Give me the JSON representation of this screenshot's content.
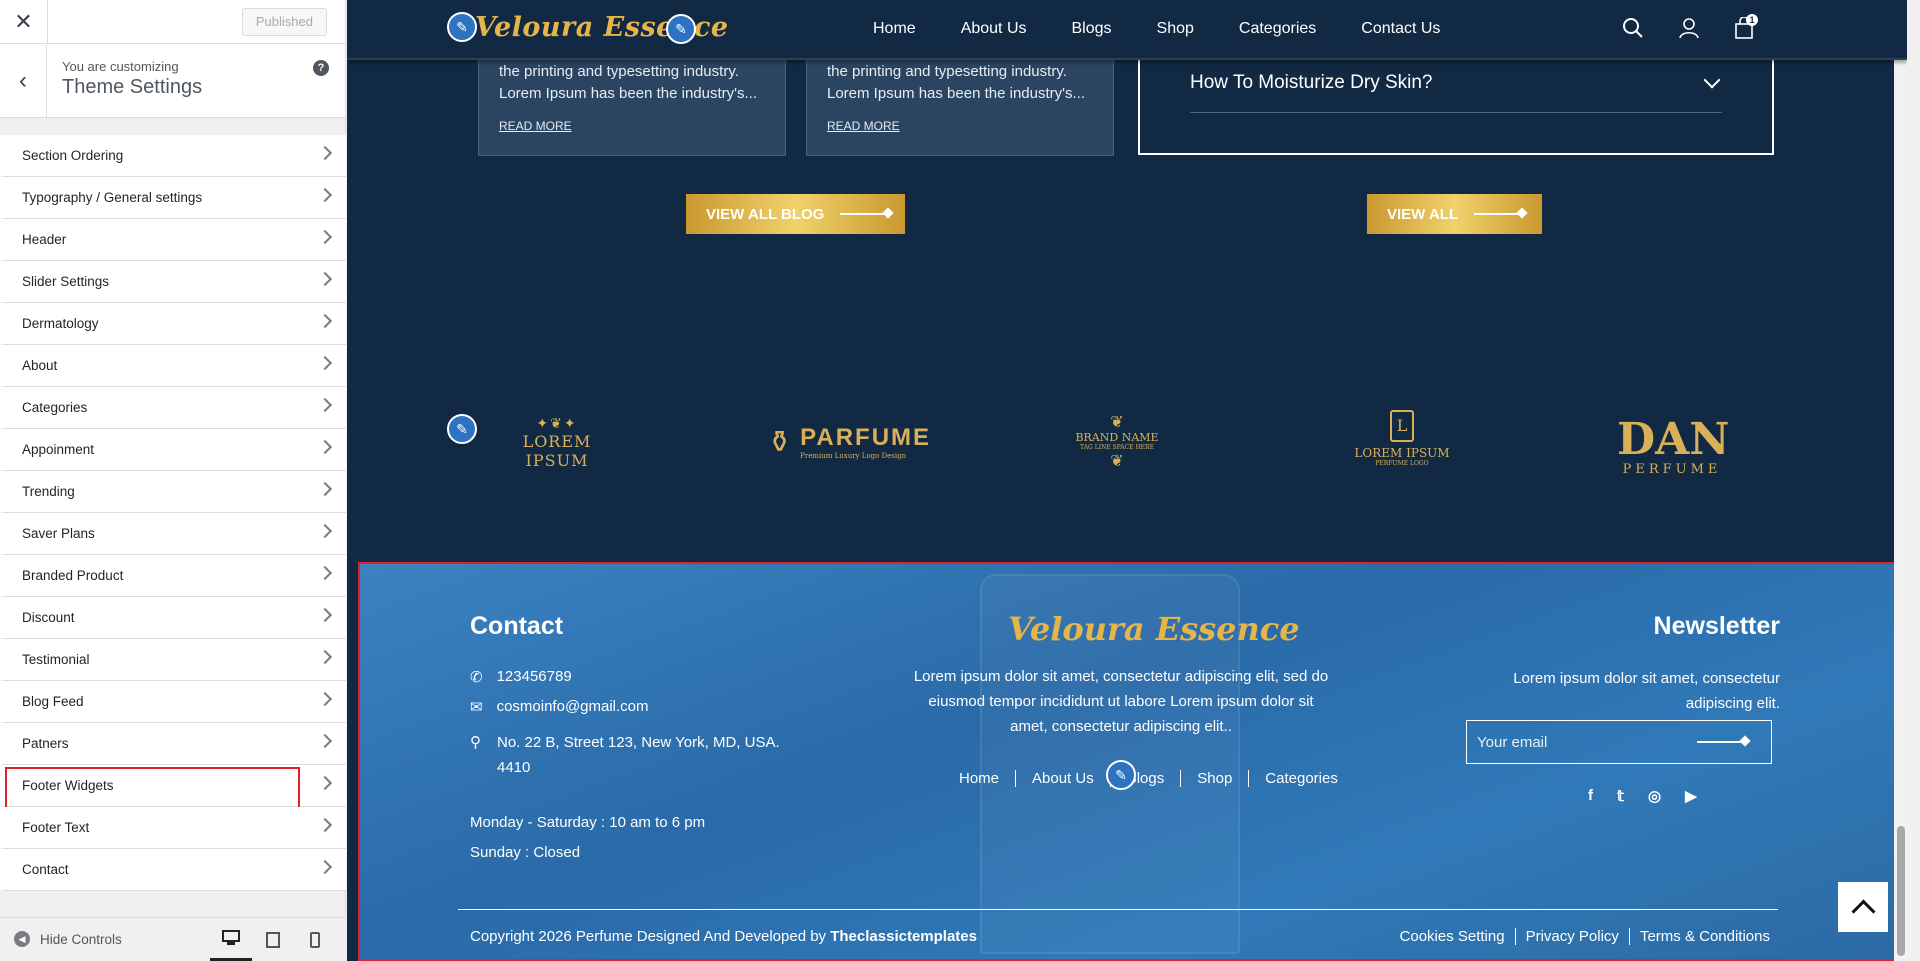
{
  "customizer": {
    "published_label": "Published",
    "customizing_label": "You are customizing",
    "section_title": "Theme Settings",
    "help_label": "?",
    "items": [
      {
        "label": "Section Ordering"
      },
      {
        "label": "Typography / General settings"
      },
      {
        "label": "Header"
      },
      {
        "label": "Slider Settings"
      },
      {
        "label": "Dermatology"
      },
      {
        "label": "About"
      },
      {
        "label": "Categories"
      },
      {
        "label": "Appoinment"
      },
      {
        "label": "Trending"
      },
      {
        "label": "Saver Plans"
      },
      {
        "label": "Branded Product"
      },
      {
        "label": "Discount"
      },
      {
        "label": "Testimonial"
      },
      {
        "label": "Blog Feed"
      },
      {
        "label": "Patners"
      },
      {
        "label": "Footer Widgets"
      },
      {
        "label": "Footer Text"
      },
      {
        "label": "Contact"
      }
    ],
    "highlighted_item": "Footer Widgets",
    "hide_controls_label": "Hide Controls",
    "devices": [
      "desktop-icon",
      "tablet-icon",
      "mobile-icon"
    ],
    "highlight_color": "#e0202a"
  },
  "site": {
    "logo_text": "Veloura Essence",
    "nav": [
      "Home",
      "About Us",
      "Blogs",
      "Shop",
      "Categories",
      "Contact Us"
    ],
    "cart_count": "1",
    "brand_gold": "#e6b54a",
    "bg_color": "#112943"
  },
  "blog": {
    "cards": [
      {
        "text": "the printing and typesetting industry. Lorem Ipsum has been the industry's...",
        "read_more": "READ MORE"
      },
      {
        "text": "the printing and typesetting industry. Lorem Ipsum has been the industry's...",
        "read_more": "READ MORE"
      }
    ],
    "view_all_blog": "VIEW ALL BLOG"
  },
  "faq": {
    "question": "How To Moisturize Dry Skin?",
    "view_all": "VIEW ALL"
  },
  "brands": [
    {
      "name": "LOREM IPSUM"
    },
    {
      "name": "PARFUME",
      "tagline": "Premium Luxury Logo Design"
    },
    {
      "name": "BRAND NAME",
      "tagline": "TAG LINE SPACE HERE"
    },
    {
      "name": "LOREM IPSUM",
      "tagline": "PERFUME LOGO",
      "monogram": "L"
    },
    {
      "name": "DAN",
      "tagline": "PERFUME"
    }
  ],
  "footer": {
    "contact_heading": "Contact",
    "phone": "123456789",
    "email": "cosmoinfo@gmail.com",
    "address_line1": "No. 22 B, Street 123, New York, MD, USA.",
    "address_line2": "4410",
    "hours_weekday": "Monday - Saturday : 10 am to 6 pm",
    "hours_sunday": "Sunday : Closed",
    "logo_text": "Veloura Essence",
    "about_text": "Lorem ipsum dolor sit amet, consectetur adipiscing elit, sed do eiusmod tempor incididunt ut labore Lorem ipsum dolor sit amet, consectetur adipiscing elit..",
    "links": [
      "Home",
      "About Us",
      "Blogs",
      "Shop",
      "Categories"
    ],
    "newsletter_heading": "Newsletter",
    "newsletter_text": "Lorem ipsum dolor sit amet, consectetur adipiscing elit.",
    "email_placeholder": "Your email",
    "socials": [
      "facebook-icon",
      "twitter-icon",
      "instagram-icon",
      "youtube-icon"
    ],
    "copyright_prefix": "Copyright 2026 Perfume Designed And Developed by ",
    "copyright_brand": "Theclassictemplates",
    "legal": [
      "Cookies Setting",
      "Privacy Policy",
      "Terms & Conditions"
    ]
  }
}
